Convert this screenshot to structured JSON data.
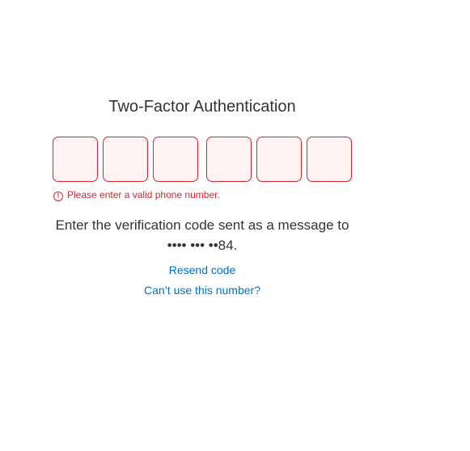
{
  "title": "Two-Factor Authentication",
  "code_inputs": [
    "",
    "",
    "",
    "",
    "",
    ""
  ],
  "error": {
    "icon": "!",
    "message": "Please enter a valid phone number."
  },
  "message": {
    "line1": "Enter the verification code sent as a message to",
    "line2": "•••• ••• ••84."
  },
  "links": {
    "resend": "Resend code",
    "cant_use": "Can’t use this number?"
  },
  "colors": {
    "error": "#d3262e",
    "input_bg": "#fff2f4",
    "link": "#0070c9",
    "text": "#333333"
  }
}
